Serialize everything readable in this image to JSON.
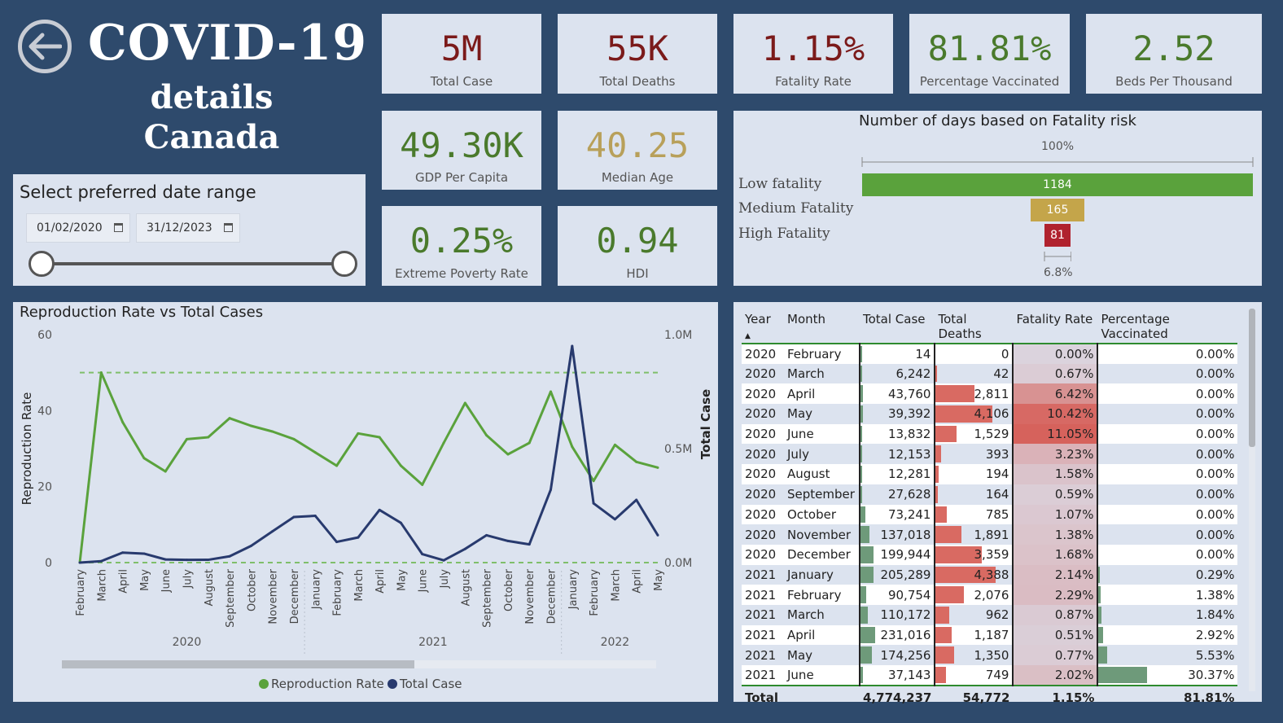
{
  "header": {
    "title": "COVID-19",
    "subtitle1": "details",
    "subtitle2": "Canada"
  },
  "kpis": {
    "total_case": {
      "value": "5M",
      "label": "Total Case",
      "color": "#7b1a1a"
    },
    "total_deaths": {
      "value": "55K",
      "label": "Total Deaths",
      "color": "#7b1a1a"
    },
    "fatality_rate": {
      "value": "1.15%",
      "label": "Fatality Rate",
      "color": "#7b1a1a"
    },
    "pct_vaccinated": {
      "value": "81.81%",
      "label": "Percentage Vaccinated",
      "color": "#4a7a2c"
    },
    "beds": {
      "value": "2.52",
      "label": "Beds Per Thousand",
      "color": "#4a7a2c"
    },
    "gdp": {
      "value": "49.30K",
      "label": "GDP Per Capita",
      "color": "#4a7a2c"
    },
    "median_age": {
      "value": "40.25",
      "label": "Median Age",
      "color": "#b8a05a"
    },
    "poverty": {
      "value": "0.25%",
      "label": "Extreme Poverty Rate",
      "color": "#4a7a2c"
    },
    "hdi": {
      "value": "0.94",
      "label": "HDI",
      "color": "#4a7a2c"
    }
  },
  "date_range": {
    "title": "Select preferred date range",
    "start": "01/02/2020",
    "end": "31/12/2023"
  },
  "fatality_bars": {
    "title": "Number of days based on Fatality risk",
    "top_pct": "100%",
    "bottom_pct": "6.8%",
    "items": [
      {
        "label": "Low fatality",
        "value": 1184,
        "display": "1184",
        "color": "#5aa23c"
      },
      {
        "label": "Medium Fatality",
        "value": 165,
        "display": "165",
        "color": "#c4a54a"
      },
      {
        "label": "High Fatality",
        "value": 81,
        "display": "81",
        "color": "#b0222e"
      }
    ]
  },
  "chart_data": {
    "type": "line",
    "title": "Reproduction Rate vs Total Cases",
    "ylabel": "Reproduction Rate",
    "y2label": "Total Case",
    "ylim": [
      0,
      60
    ],
    "y2lim": [
      0,
      1000000
    ],
    "yticks": [
      "60",
      "40",
      "20",
      "0"
    ],
    "y2ticks": [
      "1.0M",
      "0.5M",
      "0.0M"
    ],
    "categories": [
      "February",
      "March",
      "April",
      "May",
      "June",
      "July",
      "August",
      "September",
      "October",
      "November",
      "December",
      "January",
      "February",
      "March",
      "April",
      "May",
      "June",
      "July",
      "August",
      "September",
      "October",
      "November",
      "December",
      "January",
      "February",
      "March",
      "April",
      "May"
    ],
    "years": [
      {
        "label": "2020",
        "start": 0,
        "end": 10
      },
      {
        "label": "2021",
        "start": 11,
        "end": 22
      },
      {
        "label": "2022",
        "start": 23,
        "end": 27
      }
    ],
    "series": [
      {
        "name": "Reproduction Rate",
        "color": "#5aa23c",
        "axis": "left",
        "values": [
          0,
          50,
          37,
          27.5,
          24,
          32.5,
          33,
          38,
          36,
          34.5,
          32.5,
          29,
          25.5,
          34,
          33,
          25.5,
          20.5,
          31.5,
          42,
          33.5,
          28.5,
          31.5,
          45,
          30.5,
          21.5,
          31,
          26.5,
          25
        ]
      },
      {
        "name": "Total Case",
        "color": "#283a6e",
        "axis": "right",
        "values": [
          14,
          6242,
          43760,
          39392,
          13832,
          12153,
          12281,
          27628,
          73241,
          137018,
          199944,
          205289,
          90754,
          110172,
          231016,
          174256,
          37143,
          10000,
          60000,
          120000,
          95000,
          80000,
          320000,
          950000,
          260000,
          190000,
          275000,
          120000
        ]
      }
    ],
    "reference_lines": [
      50,
      0
    ]
  },
  "table": {
    "columns": [
      "Year",
      "Month",
      "Total Case",
      "Total Deaths",
      "Fatality Rate",
      "Percentage Vaccinated"
    ],
    "rows": [
      {
        "year": "2020",
        "month": "February",
        "cases": "14",
        "deaths": "0",
        "rate": "0.00%",
        "vacc": "0.00%",
        "cases_n": 14,
        "deaths_n": 0,
        "rate_n": 0.0,
        "vacc_n": 0.0
      },
      {
        "year": "2020",
        "month": "March",
        "cases": "6,242",
        "deaths": "42",
        "rate": "0.67%",
        "vacc": "0.00%",
        "cases_n": 6242,
        "deaths_n": 42,
        "rate_n": 0.67,
        "vacc_n": 0.0
      },
      {
        "year": "2020",
        "month": "April",
        "cases": "43,760",
        "deaths": "2,811",
        "rate": "6.42%",
        "vacc": "0.00%",
        "cases_n": 43760,
        "deaths_n": 2811,
        "rate_n": 6.42,
        "vacc_n": 0.0
      },
      {
        "year": "2020",
        "month": "May",
        "cases": "39,392",
        "deaths": "4,106",
        "rate": "10.42%",
        "vacc": "0.00%",
        "cases_n": 39392,
        "deaths_n": 4106,
        "rate_n": 10.42,
        "vacc_n": 0.0
      },
      {
        "year": "2020",
        "month": "June",
        "cases": "13,832",
        "deaths": "1,529",
        "rate": "11.05%",
        "vacc": "0.00%",
        "cases_n": 13832,
        "deaths_n": 1529,
        "rate_n": 11.05,
        "vacc_n": 0.0
      },
      {
        "year": "2020",
        "month": "July",
        "cases": "12,153",
        "deaths": "393",
        "rate": "3.23%",
        "vacc": "0.00%",
        "cases_n": 12153,
        "deaths_n": 393,
        "rate_n": 3.23,
        "vacc_n": 0.0
      },
      {
        "year": "2020",
        "month": "August",
        "cases": "12,281",
        "deaths": "194",
        "rate": "1.58%",
        "vacc": "0.00%",
        "cases_n": 12281,
        "deaths_n": 194,
        "rate_n": 1.58,
        "vacc_n": 0.0
      },
      {
        "year": "2020",
        "month": "September",
        "cases": "27,628",
        "deaths": "164",
        "rate": "0.59%",
        "vacc": "0.00%",
        "cases_n": 27628,
        "deaths_n": 164,
        "rate_n": 0.59,
        "vacc_n": 0.0
      },
      {
        "year": "2020",
        "month": "October",
        "cases": "73,241",
        "deaths": "785",
        "rate": "1.07%",
        "vacc": "0.00%",
        "cases_n": 73241,
        "deaths_n": 785,
        "rate_n": 1.07,
        "vacc_n": 0.0
      },
      {
        "year": "2020",
        "month": "November",
        "cases": "137,018",
        "deaths": "1,891",
        "rate": "1.38%",
        "vacc": "0.00%",
        "cases_n": 137018,
        "deaths_n": 1891,
        "rate_n": 1.38,
        "vacc_n": 0.0
      },
      {
        "year": "2020",
        "month": "December",
        "cases": "199,944",
        "deaths": "3,359",
        "rate": "1.68%",
        "vacc": "0.00%",
        "cases_n": 199944,
        "deaths_n": 3359,
        "rate_n": 1.68,
        "vacc_n": 0.0
      },
      {
        "year": "2021",
        "month": "January",
        "cases": "205,289",
        "deaths": "4,388",
        "rate": "2.14%",
        "vacc": "0.29%",
        "cases_n": 205289,
        "deaths_n": 4388,
        "rate_n": 2.14,
        "vacc_n": 0.29
      },
      {
        "year": "2021",
        "month": "February",
        "cases": "90,754",
        "deaths": "2,076",
        "rate": "2.29%",
        "vacc": "1.38%",
        "cases_n": 90754,
        "deaths_n": 2076,
        "rate_n": 2.29,
        "vacc_n": 1.38
      },
      {
        "year": "2021",
        "month": "March",
        "cases": "110,172",
        "deaths": "962",
        "rate": "0.87%",
        "vacc": "1.84%",
        "cases_n": 110172,
        "deaths_n": 962,
        "rate_n": 0.87,
        "vacc_n": 1.84
      },
      {
        "year": "2021",
        "month": "April",
        "cases": "231,016",
        "deaths": "1,187",
        "rate": "0.51%",
        "vacc": "2.92%",
        "cases_n": 231016,
        "deaths_n": 1187,
        "rate_n": 0.51,
        "vacc_n": 2.92
      },
      {
        "year": "2021",
        "month": "May",
        "cases": "174,256",
        "deaths": "1,350",
        "rate": "0.77%",
        "vacc": "5.53%",
        "cases_n": 174256,
        "deaths_n": 1350,
        "rate_n": 0.77,
        "vacc_n": 5.53
      },
      {
        "year": "2021",
        "month": "June",
        "cases": "37,143",
        "deaths": "749",
        "rate": "2.02%",
        "vacc": "30.37%",
        "cases_n": 37143,
        "deaths_n": 749,
        "rate_n": 2.02,
        "vacc_n": 30.37
      }
    ],
    "total": {
      "label": "Total",
      "cases": "4,774,237",
      "deaths": "54,772",
      "rate": "1.15%",
      "vacc": "81.81%"
    },
    "bar_colors": {
      "cases": "#6e9a7a",
      "deaths": "#d96a62",
      "vacc": "#6e9a7a"
    }
  }
}
